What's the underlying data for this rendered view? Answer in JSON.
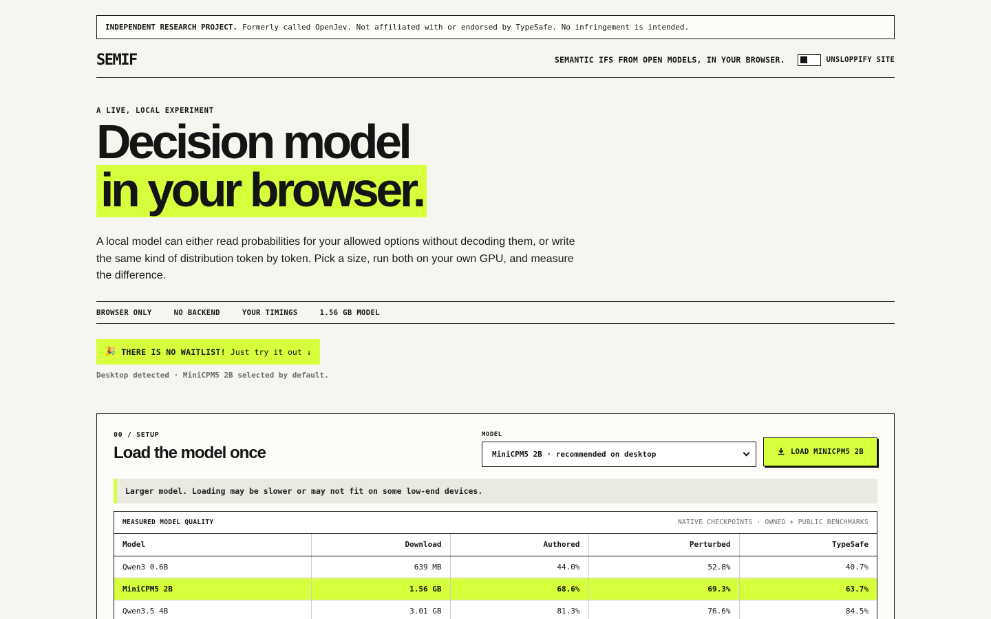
{
  "disclaimer": {
    "bold": "INDEPENDENT RESEARCH PROJECT.",
    "text": "Formerly called OpenJev. Not affiliated with or endorsed by TypeSafe. No infringement is intended."
  },
  "header": {
    "logo": "SEMIF",
    "tagline": "SEMANTIC IFS FROM OPEN MODELS, IN YOUR BROWSER.",
    "toggle_label": "UNSLOPPIFY SITE"
  },
  "hero": {
    "eyebrow": "A LIVE, LOCAL EXPERIMENT",
    "title_line1": "Decision model",
    "title_line2": "in your browser.",
    "lede": "A local model can either read probabilities for your allowed options without decoding them, or write the same kind of distribution token by token. Pick a size, run both on your own GPU, and measure the difference."
  },
  "facts": [
    "BROWSER ONLY",
    "NO BACKEND",
    "YOUR TIMINGS",
    "1.56 GB MODEL"
  ],
  "waitlist": {
    "emoji": "🎉",
    "bold": "THERE IS NO WAITLIST!",
    "text": "Just try it out ↓"
  },
  "detected": "Desktop detected · MiniCPM5 2B selected by default.",
  "setup": {
    "eyebrow": "00 / SETUP",
    "title": "Load the model once",
    "model_label": "MODEL",
    "selected_model": "MiniCPM5 2B · recommended on desktop",
    "load_button": "LOAD MINICPM5 2B",
    "note": "Larger model. Loading may be slower or may not fit on some low-end devices."
  },
  "quality": {
    "title": "MEASURED MODEL QUALITY",
    "subtitle": "NATIVE CHECKPOINTS · OWNED + PUBLIC BENCHMARKS",
    "columns": [
      "Model",
      "Download",
      "Authored",
      "Perturbed",
      "TypeSafe"
    ],
    "rows": [
      [
        "Qwen3 0.6B",
        "639 MB",
        "44.0%",
        "52.8%",
        "40.7%"
      ],
      [
        "MiniCPM5 2B",
        "1.56 GB",
        "68.6%",
        "69.3%",
        "63.7%"
      ],
      [
        "Qwen3.5 4B",
        "3.01 GB",
        "81.3%",
        "76.6%",
        "84.5%"
      ]
    ]
  },
  "colors": {
    "accent": "#d6ff3c",
    "background": "#f6f5f0",
    "ink": "#141414"
  }
}
